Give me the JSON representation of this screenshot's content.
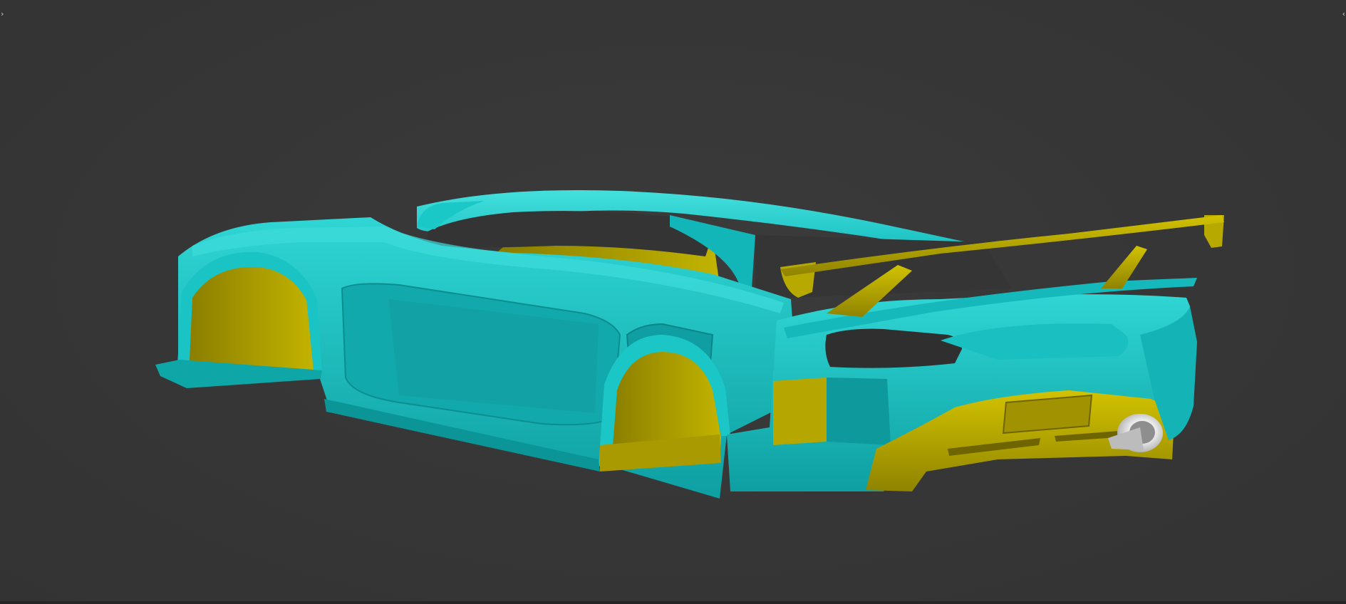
{
  "viewport": {
    "left_marker": "›",
    "right_marker": "‹"
  },
  "model": {
    "icon": "car-body-3d-model-icon",
    "colors": {
      "background": "#363636",
      "body_primary": "#16c3c3",
      "body_shadow": "#0a8c8f",
      "body_highlight": "#40e2e0",
      "inner_surface": "#b3a500",
      "inner_shadow": "#7a6e00",
      "exhaust": "#cfcfcf"
    }
  }
}
